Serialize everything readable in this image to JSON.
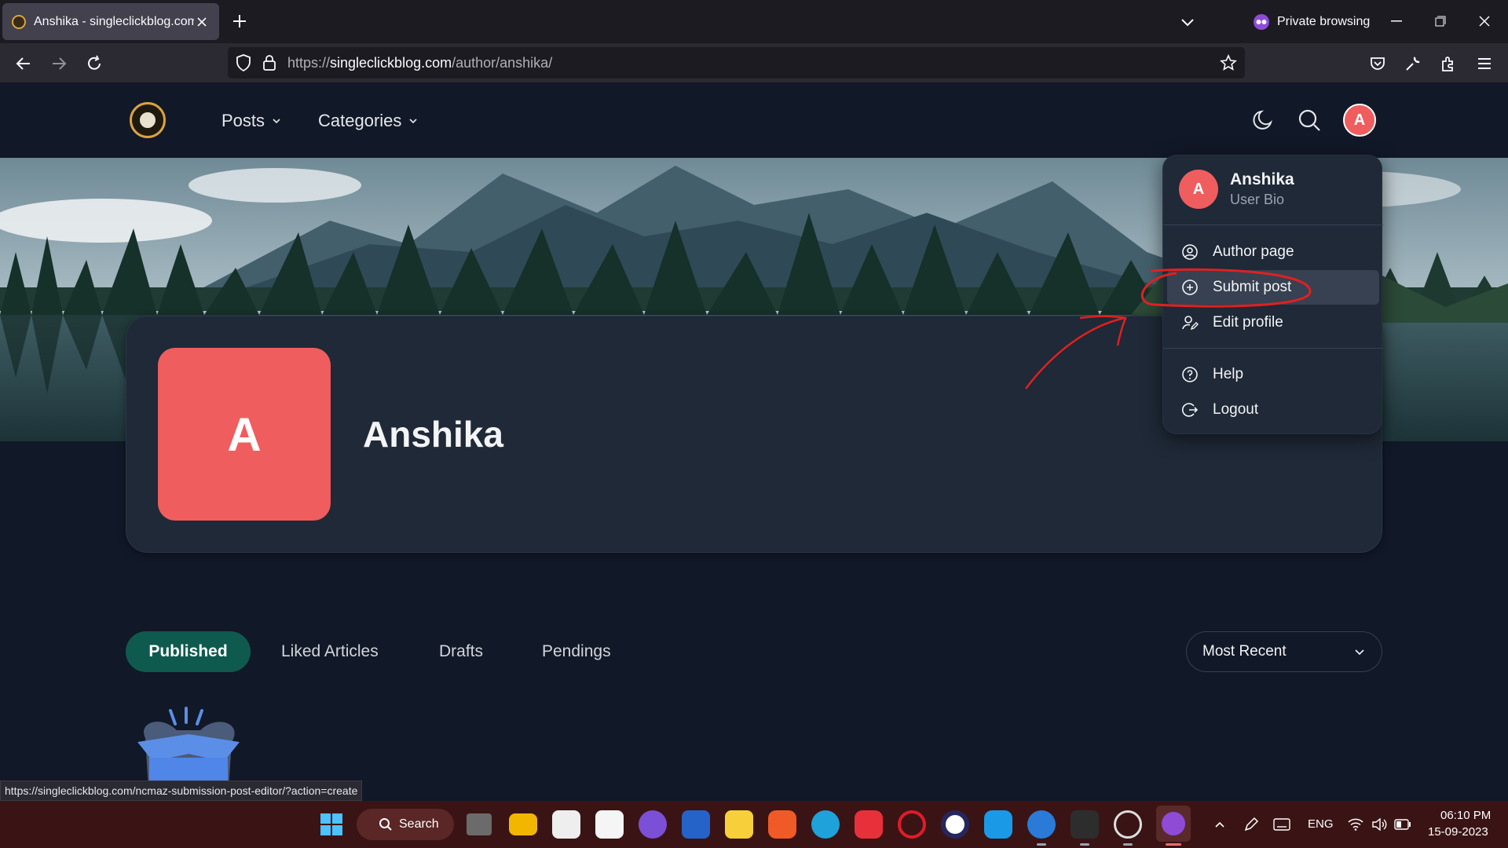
{
  "browser": {
    "tab_title": "Anshika - singleclickblog.com",
    "private_label": "Private browsing",
    "url_prefix": "https://",
    "url_host": "singleclickblog.com",
    "url_path": "/author/anshika/",
    "status_url": "https://singleclickblog.com/ncmaz-submission-post-editor/?action=create"
  },
  "site": {
    "nav": {
      "posts": "Posts",
      "categories": "Categories"
    },
    "user_initial": "A"
  },
  "profile": {
    "initial": "A",
    "name": "Anshika"
  },
  "dropdown": {
    "initial": "A",
    "name": "Anshika",
    "bio": "User Bio",
    "items": [
      {
        "label": "Author page",
        "icon": "user-circle-icon"
      },
      {
        "label": "Submit post",
        "icon": "plus-circle-icon"
      },
      {
        "label": "Edit profile",
        "icon": "user-edit-icon"
      },
      {
        "label": "Help",
        "icon": "help-circle-icon"
      },
      {
        "label": "Logout",
        "icon": "logout-icon"
      }
    ]
  },
  "tabs": [
    "Published",
    "Liked Articles",
    "Drafts",
    "Pendings"
  ],
  "sort": {
    "selected": "Most Recent"
  },
  "taskbar": {
    "search_label": "Search",
    "lang": "ENG",
    "time": "06:10 PM",
    "date": "15-09-2023"
  },
  "colors": {
    "accent_red": "#f05d5e",
    "tab_active": "#0f5a4e",
    "annotation": "#e02020"
  }
}
